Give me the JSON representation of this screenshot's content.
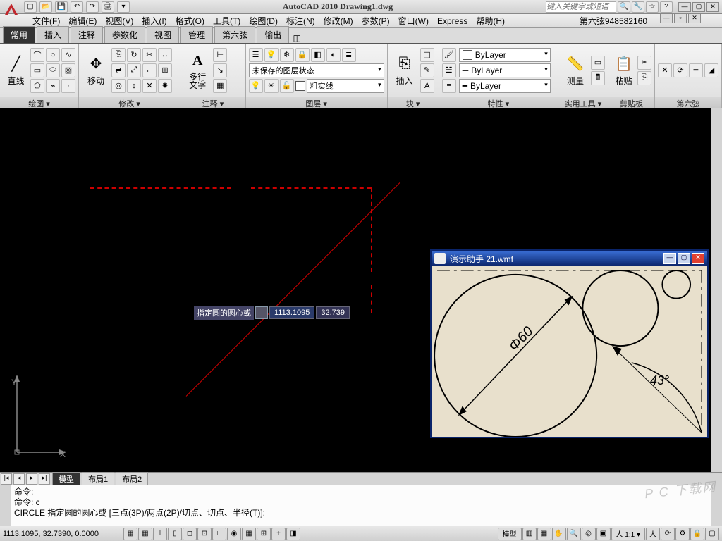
{
  "title": "AutoCAD 2010  Drawing1.dwg",
  "infocenter_placeholder": "键入关键字或短语",
  "menus": [
    "文件(F)",
    "编辑(E)",
    "视图(V)",
    "插入(I)",
    "格式(O)",
    "工具(T)",
    "绘图(D)",
    "标注(N)",
    "修改(M)",
    "参数(P)",
    "窗口(W)",
    "Express",
    "帮助(H)"
  ],
  "menu_right": "第六弦948582160",
  "ribbon_tabs": [
    "常用",
    "插入",
    "注释",
    "参数化",
    "视图",
    "管理",
    "第六弦",
    "输出"
  ],
  "active_ribbon_tab": 0,
  "panels": {
    "draw": {
      "label": "绘图 ▾",
      "big": "直线"
    },
    "modify": {
      "label": "修改 ▾",
      "big": "移动"
    },
    "annot": {
      "label": "注释 ▾",
      "big": "多行\n文字"
    },
    "layer": {
      "label": "图层 ▾",
      "state": "未保存的图层状态",
      "current": "粗实线"
    },
    "block": {
      "label": "块 ▾",
      "big": "插入"
    },
    "props": {
      "label": "特性 ▾",
      "color": "ByLayer",
      "ltype": "ByLayer",
      "lweight": "ByLayer"
    },
    "util": {
      "label": "实用工具 ▾",
      "big": "测量"
    },
    "clip": {
      "label": "剪贴板",
      "big": "粘贴"
    },
    "six": {
      "label": "第六弦"
    }
  },
  "dyn": {
    "prompt": "指定圆的圆心或",
    "x": "1113.1095",
    "y": "32.739"
  },
  "helper": {
    "title": "演示助手  21.wmf",
    "diameter": "Φ60",
    "angle": "43°"
  },
  "layout": {
    "tabs": [
      "模型",
      "布局1",
      "布局2"
    ],
    "active": 0
  },
  "cmd": {
    "l1": "命令:",
    "l2": "命令: c",
    "l3": "CIRCLE 指定圆的圆心或 [三点(3P)/两点(2P)/切点、切点、半径(T)]:"
  },
  "status": {
    "coords": "1113.1095, 32.7390, 0.0000",
    "modes": [
      "▦",
      "▦",
      "⊥",
      "▯",
      "◻",
      "⊡",
      "∟",
      "◉",
      "▦",
      "⊞",
      "+",
      "◨"
    ],
    "mspace": "模型",
    "scale": "人 1:1 ▾"
  },
  "watermark": "P C 下载网",
  "ucs": {
    "x": "X",
    "y": "Y"
  }
}
